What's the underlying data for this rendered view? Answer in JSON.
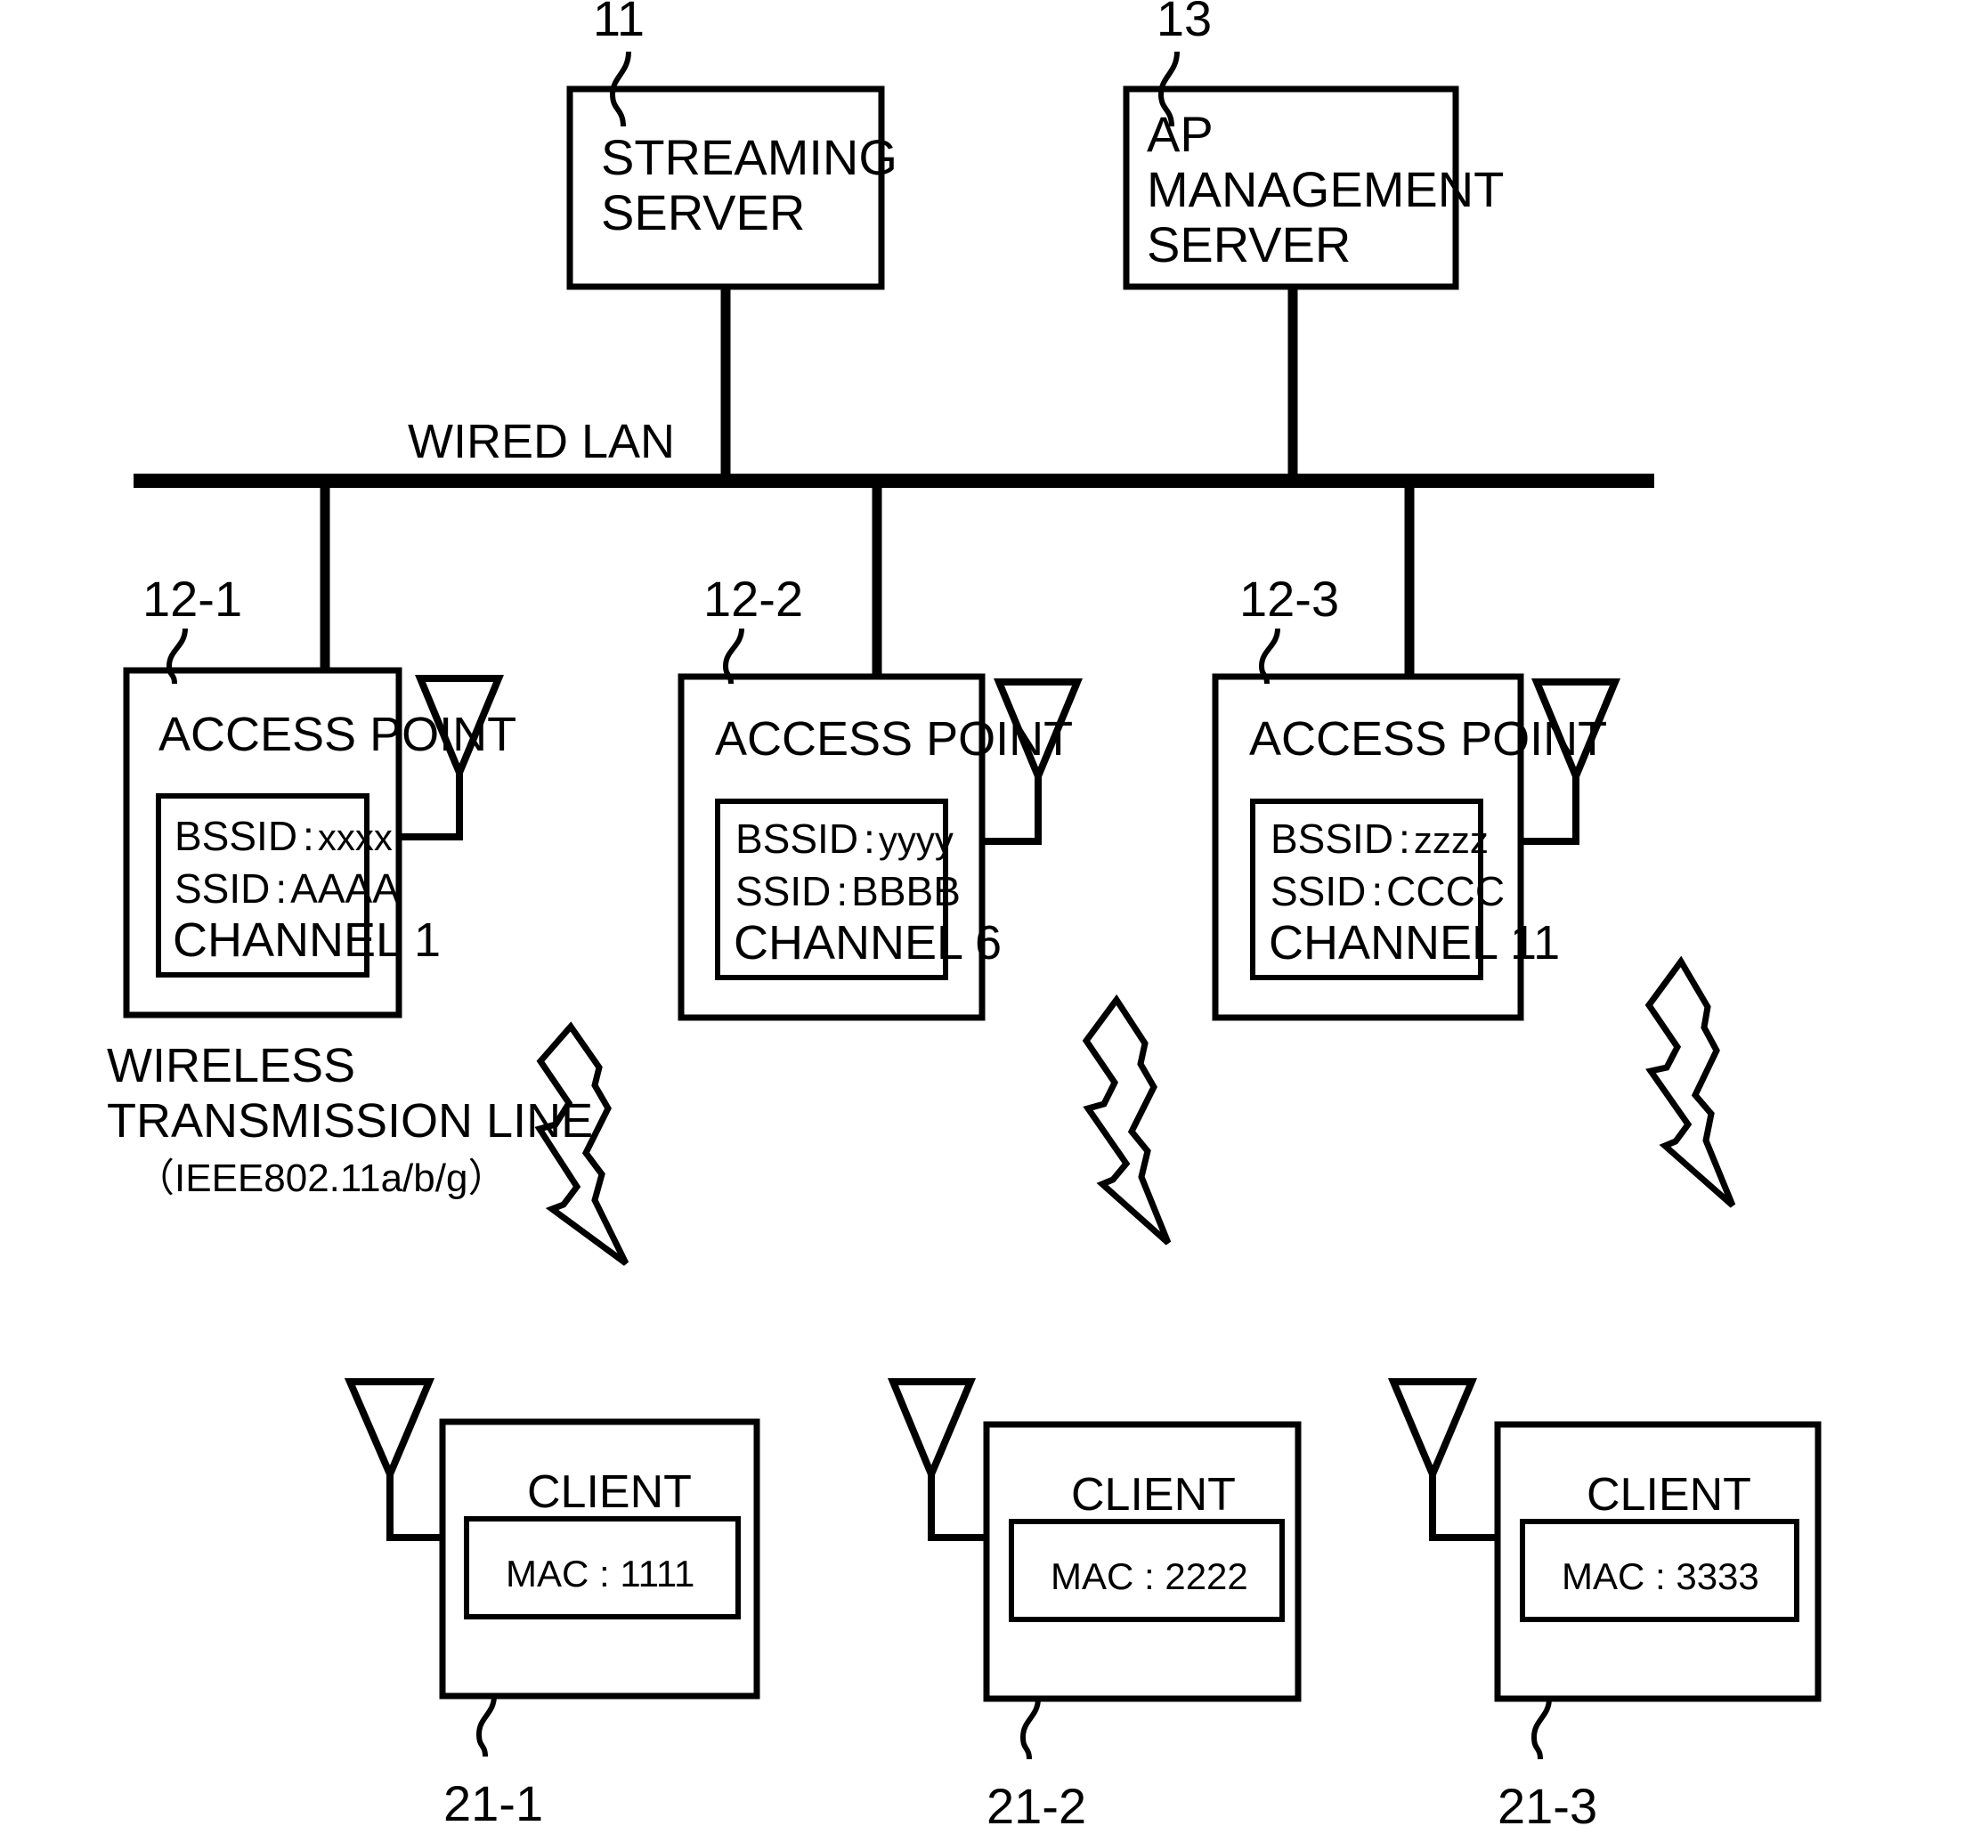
{
  "figure": {
    "type": "network-topology-diagram",
    "stroke_color": "#000000",
    "background_color": "#ffffff"
  },
  "servers": [
    {
      "ref": "11",
      "name": "streaming-server",
      "lines": [
        "STREAMING",
        "SERVER"
      ],
      "align": "center"
    },
    {
      "ref": "13",
      "name": "ap-management-server",
      "lines": [
        "AP",
        "MANAGEMENT",
        "SERVER"
      ],
      "align": "left"
    }
  ],
  "backbone": {
    "label": "WIRED LAN"
  },
  "access_points": [
    {
      "ref": "12-1",
      "title": "ACCESS POINT",
      "bssid_label": "BSSID",
      "bssid_value": "xxxx",
      "ssid_label": "SSID",
      "ssid_value": "AAAA",
      "channel": "CHANNEL 1",
      "separator": ":"
    },
    {
      "ref": "12-2",
      "title": "ACCESS POINT",
      "bssid_label": "BSSID",
      "bssid_value": "yyyy",
      "ssid_label": "SSID",
      "ssid_value": "BBBB",
      "channel": "CHANNEL 6",
      "separator": ":"
    },
    {
      "ref": "12-3",
      "title": "ACCESS POINT",
      "bssid_label": "BSSID",
      "bssid_value": "zzzz",
      "ssid_label": "SSID",
      "ssid_value": "CCCC",
      "channel": "CHANNEL 11",
      "separator": ":"
    }
  ],
  "wireless": {
    "line1": "WIRELESS",
    "line2": "TRANSMISSION LINE",
    "line3": "（IEEE802.11a/b/g）"
  },
  "clients": [
    {
      "ref": "21-1",
      "title": "CLIENT",
      "mac_label": "MAC",
      "mac_value": "1111",
      "mac_text": "MAC : 1111"
    },
    {
      "ref": "21-2",
      "title": "CLIENT",
      "mac_label": "MAC",
      "mac_value": "2222",
      "mac_text": "MAC : 2222"
    },
    {
      "ref": "21-3",
      "title": "CLIENT",
      "mac_label": "MAC",
      "mac_value": "3333",
      "mac_text": "MAC : 3333"
    }
  ]
}
